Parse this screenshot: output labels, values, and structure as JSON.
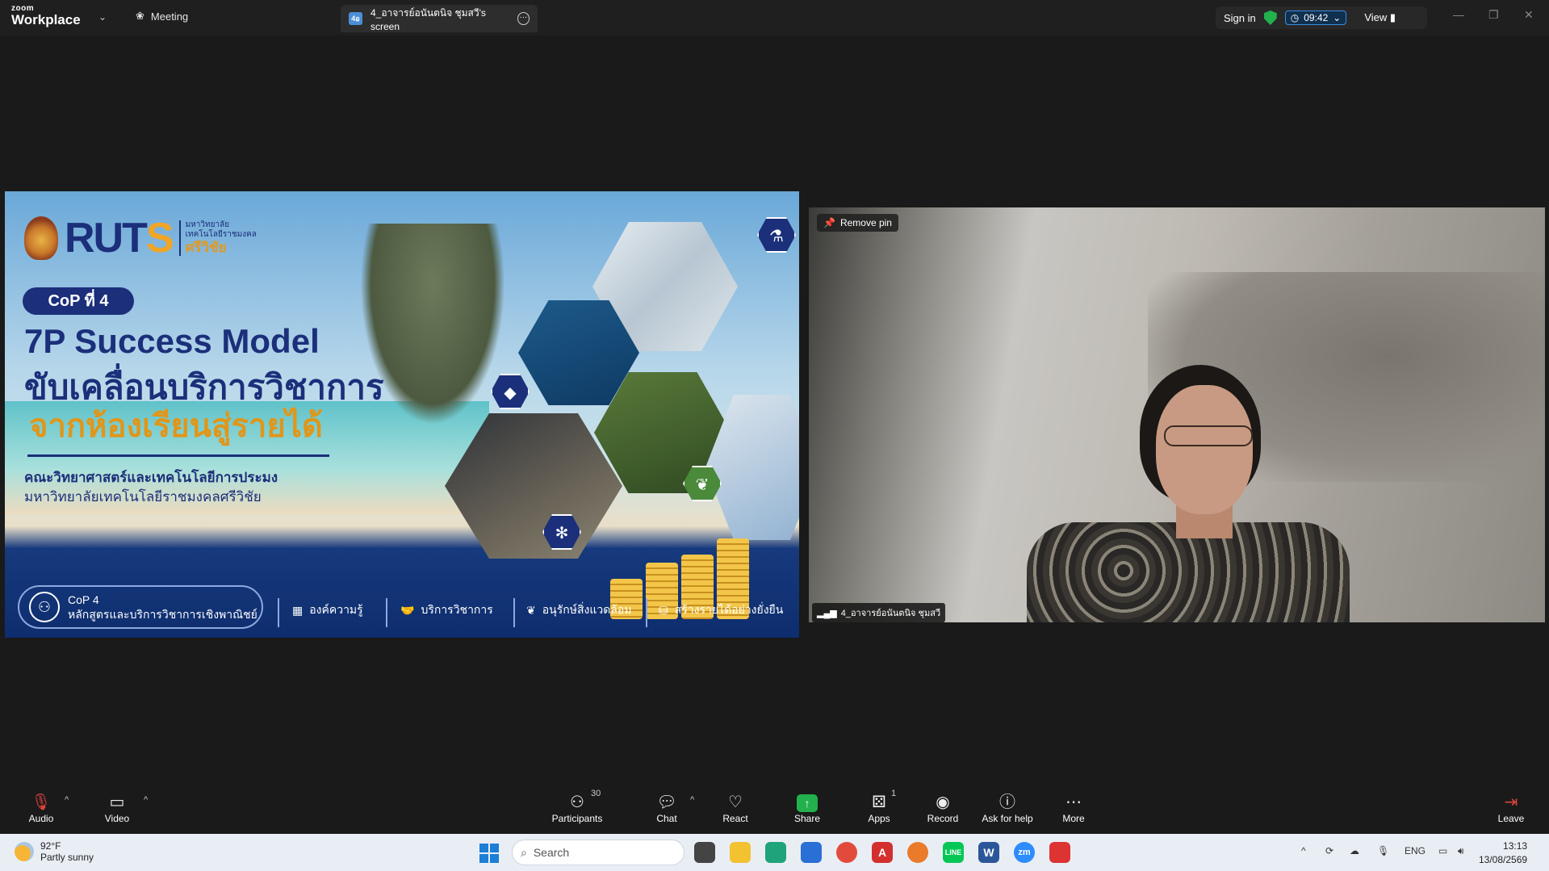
{
  "app": {
    "logo_top": "zoom",
    "logo_bottom": "Workplace"
  },
  "tabs": {
    "meeting": "Meeting",
    "share": "4_อาจารย์อนันตนิจ ชุมสวี's screen",
    "share_badge": "4อ"
  },
  "header": {
    "sign_in": "Sign in",
    "timer": "09:42",
    "view": "View"
  },
  "slide": {
    "brand": "RUTS",
    "brand_sub_line1": "มหาวิทยาลัย",
    "brand_sub_line2": "เทคโนโลยีราชมงคล",
    "brand_sub_line3": "ศรีวิชัย",
    "cop_pill": "CoP ที่ 4",
    "title_line1": "7P Success Model",
    "title_line2": "ขับเคลื่อนบริการวิชาการ",
    "title_line3": "จากห้องเรียนสู่รายได้",
    "faculty_line1": "คณะวิทยาศาสตร์และเทคโนโลยีการประมง",
    "faculty_line2": "มหาวิทยาลัยเทคโนโลยีราชมงคลศรีวิชัย",
    "cop4_title": "CoP 4",
    "cop4_subtitle": "หลักสูตรและบริการวิชาการเชิงพาณิชย์",
    "items": [
      "องค์ความรู้",
      "บริการวิชาการ",
      "อนุรักษ์สิ่งแวดล้อม",
      "สร้างรายได้อย่างยั่งยืน"
    ]
  },
  "video": {
    "remove_pin": "Remove pin",
    "participant_name": "4_อาจารย์อนันตนิจ ชุมสวี"
  },
  "toolbar": {
    "audio": "Audio",
    "video": "Video",
    "participants": "Participants",
    "participants_count": "30",
    "chat": "Chat",
    "react": "React",
    "share": "Share",
    "apps": "Apps",
    "apps_count": "1",
    "record": "Record",
    "ask_for_help": "Ask for help",
    "more": "More",
    "leave": "Leave"
  },
  "taskbar": {
    "temperature": "92°F",
    "weather": "Partly sunny",
    "search": "Search",
    "language": "ENG",
    "time": "13:13",
    "date": "13/08/2569"
  },
  "colors": {
    "accent_blue": "#1b2f7a",
    "accent_gold": "#e0961a",
    "share_green": "#22b14c"
  }
}
